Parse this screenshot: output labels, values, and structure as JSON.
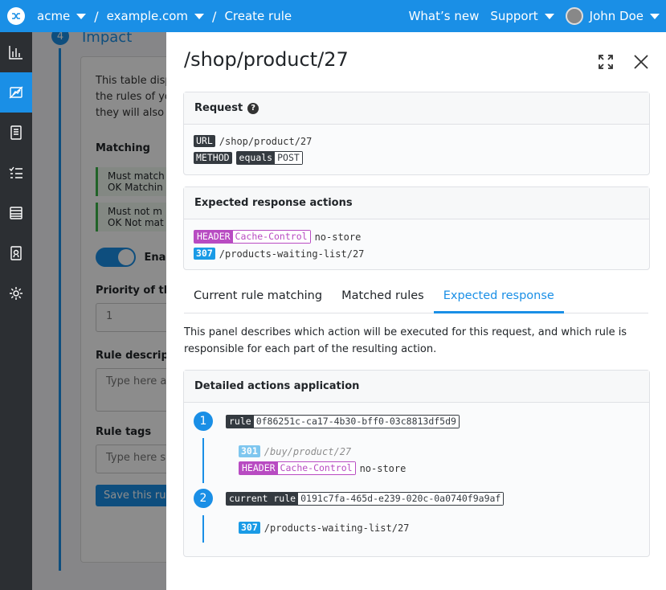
{
  "topbar": {
    "org": "acme",
    "site": "example.com",
    "page": "Create rule",
    "whats_new": "What’s new",
    "support": "Support",
    "user": "John Doe"
  },
  "background": {
    "step_number": "4",
    "step_title": "Impact",
    "intro": "This table displ… the rules of you… they will also be…",
    "intro_lines": [
      "This table displ",
      "the rules of you",
      "they will also be"
    ],
    "matching_label": "Matching",
    "row1": [
      "Must match",
      "OK",
      "Matchin"
    ],
    "row2": [
      "Must not m",
      "OK",
      "Not mat"
    ],
    "enable_label": "Enab",
    "priority_label": "Priority of the r",
    "priority_value": "1",
    "description_label": "Rule descriptio",
    "description_placeholder": "Type here an",
    "tags_label": "Rule tags",
    "tags_placeholder": "Type here so",
    "save_button": "Save this rule"
  },
  "panel": {
    "title": "/shop/product/27",
    "request": {
      "heading": "Request",
      "url_label": "URL",
      "url_value": "/shop/product/27",
      "method_label": "METHOD",
      "method_op": "equals",
      "method_value": "POST"
    },
    "expected": {
      "heading": "Expected response actions",
      "header_label": "HEADER",
      "header_name": "Cache-Control",
      "header_value": "no-store",
      "status": "307",
      "redirect": "/products-waiting-list/27"
    },
    "tabs": [
      "Current rule matching",
      "Matched rules",
      "Expected response"
    ],
    "active_tab": "Expected response",
    "description": "This panel describes which action will be executed for this request, and which rule is responsible for each part of the resulting action.",
    "detailed": {
      "heading": "Detailed actions application",
      "steps": [
        {
          "number": "1",
          "label": "rule",
          "id": "0f86251c-ca17-4b30-bff0-03c8813df5d9",
          "status": "301",
          "redirect": "/buy/product/27",
          "header_label": "HEADER",
          "header_name": "Cache-Control",
          "header_value": "no-store"
        },
        {
          "number": "2",
          "label": "current rule",
          "id": "0191c7fa-465d-e239-020c-0a0740f9a9af",
          "status": "307",
          "redirect": "/products-waiting-list/27"
        }
      ]
    }
  },
  "colors": {
    "brand": "#1a8fe6",
    "sidebar": "#2c2f33",
    "header_tag": "#b84bc2",
    "status_tag": "#1a9be6"
  }
}
